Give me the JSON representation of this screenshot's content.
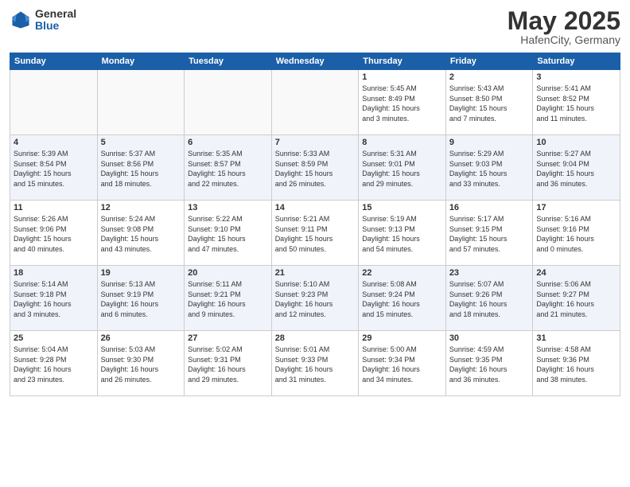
{
  "logo": {
    "general": "General",
    "blue": "Blue"
  },
  "header": {
    "month": "May 2025",
    "location": "HafenCity, Germany"
  },
  "weekdays": [
    "Sunday",
    "Monday",
    "Tuesday",
    "Wednesday",
    "Thursday",
    "Friday",
    "Saturday"
  ],
  "weeks": [
    [
      {
        "day": "",
        "info": ""
      },
      {
        "day": "",
        "info": ""
      },
      {
        "day": "",
        "info": ""
      },
      {
        "day": "",
        "info": ""
      },
      {
        "day": "1",
        "info": "Sunrise: 5:45 AM\nSunset: 8:49 PM\nDaylight: 15 hours\nand 3 minutes."
      },
      {
        "day": "2",
        "info": "Sunrise: 5:43 AM\nSunset: 8:50 PM\nDaylight: 15 hours\nand 7 minutes."
      },
      {
        "day": "3",
        "info": "Sunrise: 5:41 AM\nSunset: 8:52 PM\nDaylight: 15 hours\nand 11 minutes."
      }
    ],
    [
      {
        "day": "4",
        "info": "Sunrise: 5:39 AM\nSunset: 8:54 PM\nDaylight: 15 hours\nand 15 minutes."
      },
      {
        "day": "5",
        "info": "Sunrise: 5:37 AM\nSunset: 8:56 PM\nDaylight: 15 hours\nand 18 minutes."
      },
      {
        "day": "6",
        "info": "Sunrise: 5:35 AM\nSunset: 8:57 PM\nDaylight: 15 hours\nand 22 minutes."
      },
      {
        "day": "7",
        "info": "Sunrise: 5:33 AM\nSunset: 8:59 PM\nDaylight: 15 hours\nand 26 minutes."
      },
      {
        "day": "8",
        "info": "Sunrise: 5:31 AM\nSunset: 9:01 PM\nDaylight: 15 hours\nand 29 minutes."
      },
      {
        "day": "9",
        "info": "Sunrise: 5:29 AM\nSunset: 9:03 PM\nDaylight: 15 hours\nand 33 minutes."
      },
      {
        "day": "10",
        "info": "Sunrise: 5:27 AM\nSunset: 9:04 PM\nDaylight: 15 hours\nand 36 minutes."
      }
    ],
    [
      {
        "day": "11",
        "info": "Sunrise: 5:26 AM\nSunset: 9:06 PM\nDaylight: 15 hours\nand 40 minutes."
      },
      {
        "day": "12",
        "info": "Sunrise: 5:24 AM\nSunset: 9:08 PM\nDaylight: 15 hours\nand 43 minutes."
      },
      {
        "day": "13",
        "info": "Sunrise: 5:22 AM\nSunset: 9:10 PM\nDaylight: 15 hours\nand 47 minutes."
      },
      {
        "day": "14",
        "info": "Sunrise: 5:21 AM\nSunset: 9:11 PM\nDaylight: 15 hours\nand 50 minutes."
      },
      {
        "day": "15",
        "info": "Sunrise: 5:19 AM\nSunset: 9:13 PM\nDaylight: 15 hours\nand 54 minutes."
      },
      {
        "day": "16",
        "info": "Sunrise: 5:17 AM\nSunset: 9:15 PM\nDaylight: 15 hours\nand 57 minutes."
      },
      {
        "day": "17",
        "info": "Sunrise: 5:16 AM\nSunset: 9:16 PM\nDaylight: 16 hours\nand 0 minutes."
      }
    ],
    [
      {
        "day": "18",
        "info": "Sunrise: 5:14 AM\nSunset: 9:18 PM\nDaylight: 16 hours\nand 3 minutes."
      },
      {
        "day": "19",
        "info": "Sunrise: 5:13 AM\nSunset: 9:19 PM\nDaylight: 16 hours\nand 6 minutes."
      },
      {
        "day": "20",
        "info": "Sunrise: 5:11 AM\nSunset: 9:21 PM\nDaylight: 16 hours\nand 9 minutes."
      },
      {
        "day": "21",
        "info": "Sunrise: 5:10 AM\nSunset: 9:23 PM\nDaylight: 16 hours\nand 12 minutes."
      },
      {
        "day": "22",
        "info": "Sunrise: 5:08 AM\nSunset: 9:24 PM\nDaylight: 16 hours\nand 15 minutes."
      },
      {
        "day": "23",
        "info": "Sunrise: 5:07 AM\nSunset: 9:26 PM\nDaylight: 16 hours\nand 18 minutes."
      },
      {
        "day": "24",
        "info": "Sunrise: 5:06 AM\nSunset: 9:27 PM\nDaylight: 16 hours\nand 21 minutes."
      }
    ],
    [
      {
        "day": "25",
        "info": "Sunrise: 5:04 AM\nSunset: 9:28 PM\nDaylight: 16 hours\nand 23 minutes."
      },
      {
        "day": "26",
        "info": "Sunrise: 5:03 AM\nSunset: 9:30 PM\nDaylight: 16 hours\nand 26 minutes."
      },
      {
        "day": "27",
        "info": "Sunrise: 5:02 AM\nSunset: 9:31 PM\nDaylight: 16 hours\nand 29 minutes."
      },
      {
        "day": "28",
        "info": "Sunrise: 5:01 AM\nSunset: 9:33 PM\nDaylight: 16 hours\nand 31 minutes."
      },
      {
        "day": "29",
        "info": "Sunrise: 5:00 AM\nSunset: 9:34 PM\nDaylight: 16 hours\nand 34 minutes."
      },
      {
        "day": "30",
        "info": "Sunrise: 4:59 AM\nSunset: 9:35 PM\nDaylight: 16 hours\nand 36 minutes."
      },
      {
        "day": "31",
        "info": "Sunrise: 4:58 AM\nSunset: 9:36 PM\nDaylight: 16 hours\nand 38 minutes."
      }
    ]
  ]
}
